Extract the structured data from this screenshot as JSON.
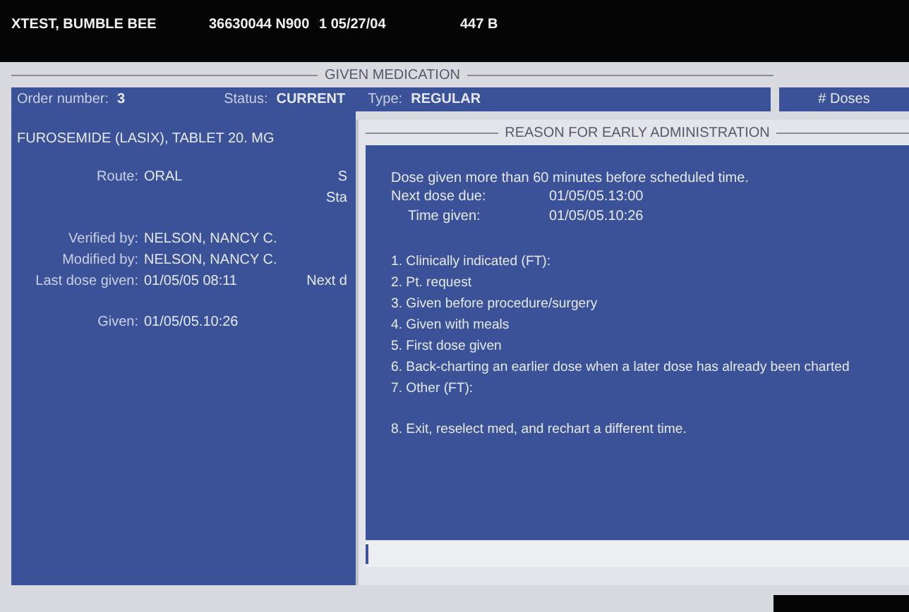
{
  "header": {
    "patient": "XTEST, BUMBLE BEE",
    "id": "36630044 N900",
    "date": "1 05/27/04",
    "code": "447 B"
  },
  "medication": {
    "title": "GIVEN MEDICATION",
    "order_label": "Order number:",
    "order_number": "3",
    "status_label": "Status:",
    "status": "CURRENT",
    "type_label": "Type:",
    "type": "REGULAR",
    "doses_label": "# Doses"
  },
  "order": {
    "drug": "FUROSEMIDE (LASIX), TABLET 20. MG",
    "fields": [
      {
        "label": "Route:",
        "value": "ORAL",
        "fragment": "S"
      },
      {
        "fragment": "Sta"
      },
      {
        "label": "Verified by:",
        "value": "NELSON, NANCY C."
      },
      {
        "label": "Modified by:",
        "value": "NELSON, NANCY C."
      },
      {
        "label": "Last dose given:",
        "value": "01/05/05 08:11",
        "fragment": "Next d"
      },
      {
        "label": "Given:",
        "value": "01/05/05.10:26"
      }
    ]
  },
  "dialog": {
    "title": "REASON FOR EARLY ADMINISTRATION",
    "message": "Dose given more than  60 minutes before scheduled time.",
    "info": [
      {
        "label": "Next dose due:",
        "value": "01/05/05.13:00"
      },
      {
        "label": "Time given:",
        "value": "01/05/05.10:26"
      }
    ],
    "options": [
      "1. Clinically indicated (FT):",
      "2. Pt. request",
      "3. Given before procedure/surgery",
      "4. Given with meals",
      "5. First dose given",
      "6. Back-charting an earlier dose when a later dose has already been charted",
      "7. Other (FT):",
      "8. Exit, reselect med, and rechart a different time."
    ]
  }
}
